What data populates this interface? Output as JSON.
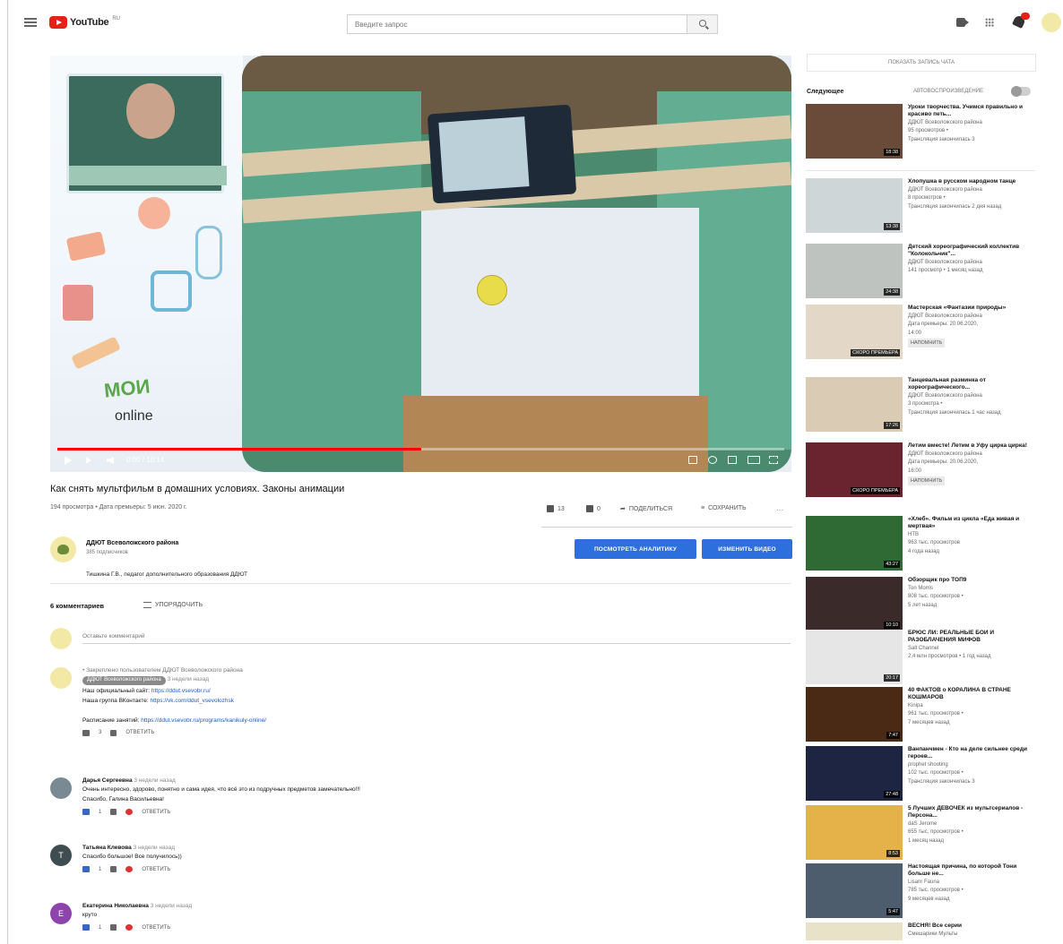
{
  "header": {
    "logo_text": "YouTube",
    "logo_sup": "RU",
    "search_placeholder": "Введите запрос"
  },
  "player": {
    "brand_line1": "МОИ",
    "brand_line2": "online",
    "time": "0:00 / 10:14",
    "progress_fraction": 0.5
  },
  "video": {
    "title": "Как снять мультфильм в домашних условиях. Законы анимации",
    "meta": "194 просмотра • Дата премьеры: 5 июн. 2020 г.",
    "likes": "13",
    "dislikes": "0",
    "share_label": "ПОДЕЛИТЬСЯ",
    "save_label": "СОХРАНИТЬ",
    "more_label": "..."
  },
  "channel": {
    "name": "ДДЮТ Всеволожского района",
    "subs": "385 подписчиков",
    "description": "Тишкина Г.В., педагог дополнительного образования ДДЮТ",
    "analytics_button": "ПОСМОТРЕТЬ АНАЛИТИКУ",
    "edit_button": "ИЗМЕНИТЬ ВИДЕО"
  },
  "comments": {
    "count_label": "6 комментариев",
    "sort_label": "УПОРЯДОЧИТЬ",
    "add_placeholder": "Оставьте комментарий",
    "items": [
      {
        "pinned": "Закреплено пользователем ДДЮТ Всеволожского района",
        "author": "ДДЮТ Всеволожского района",
        "time": "3 недели назад",
        "line1_label": "Наш официальный сайт:",
        "line1_link": "https://ddut.vsevobr.ru/",
        "line2_label": "Наша группа ВКонтакте:",
        "line2_link": "https://vk.com/ddut_vsevolozhsk",
        "line3_label": "Расписание занятий:",
        "line3_link": "https://ddut.vsevobr.ru/programs/kanikuly-online/",
        "likes": "3",
        "reply": "ОТВЕТИТЬ",
        "avatar_letter": ""
      },
      {
        "author": "Дарья Сергеевна",
        "time": "3 недели назад",
        "text": "Очень интересно, здорово, понятно и сама идея, что всё это из подручных предметов замечательно!!!",
        "text2": "Спасибо, Галина Васильевна!",
        "likes": "1",
        "reply": "ОТВЕТИТЬ",
        "avatar_letter": "",
        "avatar_color": "#7a8a95"
      },
      {
        "author": "Татьяна Клевова",
        "time": "3 недели назад",
        "text": "Спасибо большое! Все получилось))",
        "likes": "1",
        "reply": "ОТВЕТИТЬ",
        "avatar_letter": "Т",
        "avatar_color": "#3f4d52"
      },
      {
        "author": "Екатерина Николаевна",
        "time": "3 недели назад",
        "text": "круто",
        "likes": "1",
        "reply": "ОТВЕТИТЬ",
        "avatar_letter": "Е",
        "avatar_color": "#8e44ad"
      }
    ]
  },
  "sidebar": {
    "chat_label": "ПОКАЗАТЬ ЗАПИСЬ ЧАТА",
    "next_label": "Следующее",
    "autoplay_label": "АВТОВОСПРОИЗВЕДЕНИЕ",
    "recommended": [
      {
        "title": "Уроки творчества. Учимся правильно и красиво петь...",
        "channel": "ДДЮТ Всеволожского района",
        "views": "95 просмотров •",
        "time": "Трансляция закончилась 3",
        "duration": "18:38",
        "badge": ""
      },
      {
        "title": "Хлопушка в русском народном танце",
        "channel": "ДДЮТ Всеволожского района",
        "views": "8 просмотров •",
        "time": "Трансляция закончилась 2 дня назад",
        "duration": "13:38",
        "badge": ""
      },
      {
        "title": "Детский хореографический коллектив \"Колокольчик\"...",
        "channel": "ДДЮТ Всеволожского района",
        "views": "141 просмотр • 1 месяц назад",
        "time": "",
        "duration": "24:38",
        "badge": ""
      },
      {
        "title": "Мастерская «Фантазии природы»",
        "channel": "ДДЮТ Всеволожского района",
        "views": "Дата премьеры: 20.06.2020,",
        "time": "14:00",
        "duration": "СКОРО ПРЕМЬЕРА",
        "badge": "НАПОМНИТЬ"
      },
      {
        "title": "Танцевальная разминка от хореографического...",
        "channel": "ДДЮТ Всеволожского района",
        "views": "3 просмотра •",
        "time": "Трансляция закончилась 1 час назад",
        "duration": "17:26",
        "badge": ""
      },
      {
        "title": "Летим вместе! Летим в Уфу цирка цирка!",
        "channel": "ДДЮТ Всеволожского района",
        "views": "Дата премьеры: 20.06.2020,",
        "time": "16:00",
        "duration": "СКОРО ПРЕМЬЕРА",
        "badge": "НАПОМНИТЬ"
      },
      {
        "title": "«Хлеб». Фильм из цикла «Еда живая и мертвая»",
        "channel": "НТВ",
        "views": "963 тыс. просмотров",
        "time": "4 года назад",
        "duration": "43:27",
        "badge": ""
      },
      {
        "title": "Обзорщик про ТОП9",
        "channel": "Ton Morris",
        "views": "808 тыс. просмотров •",
        "time": "5 лет назад",
        "duration": "10:10",
        "badge": ""
      },
      {
        "title": "БРЮС ЛИ: РЕАЛЬНЫЕ БОИ И РАЗОБЛАЧЕНИЯ МИФОВ",
        "channel": "Salt Channel",
        "views": "2,4 млн просмотров • 1 год назад",
        "time": "",
        "duration": "20:17",
        "badge": ""
      },
      {
        "title": "40 ФАКТОВ о КОРАЛИНА В СТРАНЕ КОШМАРОВ",
        "channel": "Kinipa",
        "views": "961 тыс. просмотров •",
        "time": "7 месяцев назад",
        "duration": "7:47",
        "badge": ""
      },
      {
        "title": "Ванпанчмен - Кто на деле сильнее среди героев...",
        "channel": "prophet shooting",
        "views": "102 тыс. просмотров •",
        "time": "Трансляция закончилась 3",
        "duration": "27:48",
        "badge": ""
      },
      {
        "title": "5 Лучших ДЕВОЧЕК из мультсериалов - Персона...",
        "channel": "daS Jerome",
        "views": "655 тыс. просмотров •",
        "time": "1 месяц назад",
        "duration": "8:53",
        "badge": ""
      },
      {
        "title": "Настоящая причина, по которой Тони больше не...",
        "channel": "Lisanr Fauna",
        "views": "785 тыс. просмотров •",
        "time": "9 месяцев назад",
        "duration": "5:47",
        "badge": ""
      },
      {
        "title": "ВЕСНЯ! Все серии",
        "channel": "Смешарики Мульты",
        "views": "",
        "time": "",
        "duration": "",
        "badge": ""
      }
    ]
  },
  "colors": {
    "accent_blue": "#2e6fde",
    "progress_red": "#ff0000",
    "link_blue": "#1a5cc4"
  }
}
